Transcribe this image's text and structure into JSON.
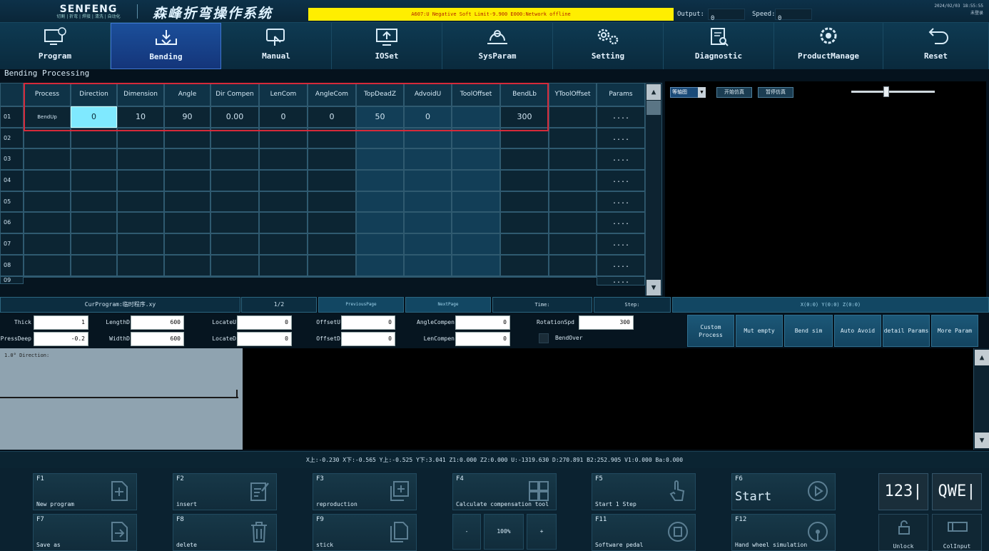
{
  "header": {
    "brand": "SENFENG",
    "brand_sub": "切割 | 折弯 | 焊接 | 清洗 | 自动化",
    "system_title": "森峰折弯操作系统",
    "alarm": "A607:U Negative Soft Limit-9.900    E000:Network offline",
    "output_label": "Output:",
    "output_value": "0",
    "speed_label": "Speed:",
    "speed_value": "0",
    "date": "2024/02/03 18:55:55",
    "user": "未登录"
  },
  "nav": {
    "items": [
      {
        "label": "Program",
        "icon": "program-icon"
      },
      {
        "label": "Bending",
        "icon": "bending-icon",
        "active": true
      },
      {
        "label": "Manual",
        "icon": "manual-icon"
      },
      {
        "label": "IOSet",
        "icon": "ioset-icon"
      },
      {
        "label": "SysParam",
        "icon": "sysparam-icon"
      },
      {
        "label": "Setting",
        "icon": "setting-icon"
      },
      {
        "label": "Diagnostic",
        "icon": "diagnostic-icon"
      },
      {
        "label": "ProductManage",
        "icon": "product-manage-icon"
      },
      {
        "label": "Reset",
        "icon": "reset-icon"
      }
    ]
  },
  "bending": {
    "title": "Bending Processing",
    "columns": [
      "Process",
      "Direction",
      "Dimension",
      "Angle",
      "Dir Compen",
      "LenCom",
      "AngleCom",
      "TopDeadZ",
      "AdvoidU",
      "ToolOffset",
      "BendLb",
      "YToolOffset",
      "Params"
    ],
    "row_numbers": [
      "01",
      "02",
      "03",
      "04",
      "05",
      "06",
      "07",
      "08",
      "09"
    ],
    "rows": [
      [
        "BendUp",
        "0",
        "10",
        "90",
        "0.00",
        "0",
        "0",
        "50",
        "0",
        "",
        "300",
        "",
        "...."
      ],
      [
        "",
        "",
        "",
        "",
        "",
        "",
        "",
        "",
        "",
        "",
        "",
        "",
        "...."
      ],
      [
        "",
        "",
        "",
        "",
        "",
        "",
        "",
        "",
        "",
        "",
        "",
        "",
        "...."
      ],
      [
        "",
        "",
        "",
        "",
        "",
        "",
        "",
        "",
        "",
        "",
        "",
        "",
        "...."
      ],
      [
        "",
        "",
        "",
        "",
        "",
        "",
        "",
        "",
        "",
        "",
        "",
        "",
        "...."
      ],
      [
        "",
        "",
        "",
        "",
        "",
        "",
        "",
        "",
        "",
        "",
        "",
        "",
        "...."
      ],
      [
        "",
        "",
        "",
        "",
        "",
        "",
        "",
        "",
        "",
        "",
        "",
        "",
        "...."
      ],
      [
        "",
        "",
        "",
        "",
        "",
        "",
        "",
        "",
        "",
        "",
        "",
        "",
        "...."
      ],
      [
        "",
        "",
        "",
        "",
        "",
        "",
        "",
        "",
        "",
        "",
        "",
        "",
        "...."
      ]
    ],
    "scroll_up": "▲",
    "scroll_down": "▼"
  },
  "sim": {
    "view_select": "等轴图",
    "start_sim": "开始仿真",
    "pause_sim": "暂停仿真"
  },
  "infobar": {
    "cur_program": "CurProgram:临时程序.xy",
    "page": "1/2",
    "prev": "PreviousPage",
    "next": "NextPage",
    "time": "Time:",
    "step": "Step:",
    "coords": "X(0:0) Y(0:0) Z(0:0)"
  },
  "params": {
    "thick_label": "Thick",
    "thick_value": "1",
    "press_label": "PressDeep",
    "press_value": "-0.2",
    "length_label": "LengthD",
    "length_value": "600",
    "width_label": "WidthD",
    "width_value": "600",
    "locate_u_label": "LocateU",
    "locate_u_value": "0",
    "locate_d_label": "LocateD",
    "locate_d_value": "0",
    "offset_u_label": "OffsetU",
    "offset_u_value": "0",
    "offset_d_label": "OffsetD",
    "offset_d_value": "0",
    "angle_compen_label": "AngleCompen",
    "angle_compen_value": "0",
    "len_compen_label": "LenCompen",
    "len_compen_value": "0",
    "rotation_label": "RotationSpd",
    "rotation_value": "300",
    "bendover_label": "BendOver"
  },
  "side_buttons": [
    {
      "label": "Custom Process"
    },
    {
      "label": "Mut empty"
    },
    {
      "label": "Bend sim"
    },
    {
      "label": "Auto Avoid"
    },
    {
      "label": "detail Params"
    },
    {
      "label": "More Param"
    }
  ],
  "drawing": {
    "direction_text": "1.0° Direction:"
  },
  "axes": "X上:-0.230   X下:-0.565   Y上:-0.525   Y下:3.041   Z1:0.000   Z2:0.000   U:-1319.630   D:270.891   B2:252.905   V1:0.000   Ba:0.000",
  "fkeys": [
    {
      "key": "F1",
      "label": "New program"
    },
    {
      "key": "F2",
      "label": "insert"
    },
    {
      "key": "F3",
      "label": "reproduction"
    },
    {
      "key": "F4",
      "label": "Calculate compensation tool"
    },
    {
      "key": "F5",
      "label": "Start 1 Step"
    },
    {
      "key": "F6",
      "label": "Start"
    },
    {
      "key": "F7",
      "label": "Save as"
    },
    {
      "key": "F8",
      "label": "delete"
    },
    {
      "key": "F9",
      "label": "stick"
    },
    {
      "key": "F11",
      "label": "Software pedal"
    },
    {
      "key": "F12",
      "label": "Hand wheel simulation"
    }
  ],
  "zoom": {
    "minus": "-",
    "value": "100%",
    "plus": "+"
  },
  "keyboard": {
    "numeric": "123",
    "alpha": "QWE",
    "unlock": "Unlock",
    "col_input": "ColInput"
  }
}
